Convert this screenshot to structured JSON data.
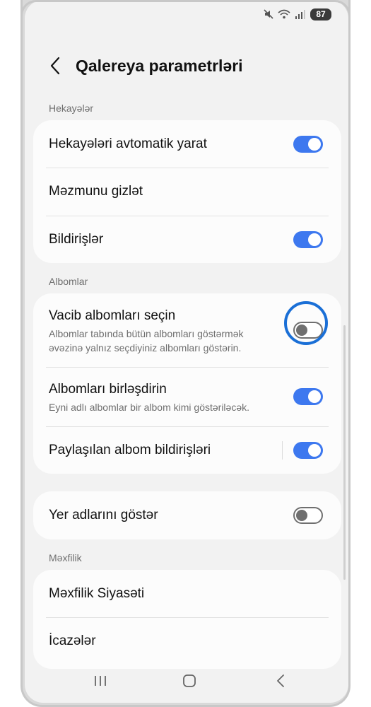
{
  "status_bar": {
    "battery": "87",
    "icons": [
      "mute-icon",
      "wifi-icon",
      "signal-icon"
    ]
  },
  "header": {
    "title": "Qalereya parametrləri",
    "back_icon": "chevron-left-icon"
  },
  "sections": {
    "stories": {
      "label": "Hekayələr",
      "items": [
        {
          "title": "Hekayələri avtomatik yarat",
          "toggle": true
        },
        {
          "title": "Məzmunu gizlət"
        },
        {
          "title": "Bildirişlər",
          "toggle": true
        }
      ]
    },
    "albums": {
      "label": "Albomlar",
      "items": [
        {
          "title": "Vacib albomları seçin",
          "subtitle_line1": "Albomlar tabında bütün albomları göstərmək",
          "subtitle_line2": "əvəzinə yalnız seçdiyiniz albomları göstərin.",
          "toggle": false
        },
        {
          "title": "Albomları birləşdirin",
          "subtitle": "Eyni adlı albomlar bir albom kimi göstəriləcək.",
          "toggle": true
        },
        {
          "title": "Paylaşılan albom bildirişləri",
          "toggle": true
        }
      ]
    },
    "location": {
      "items": [
        {
          "title": "Yer adlarını göstər",
          "toggle": false
        }
      ]
    },
    "privacy": {
      "label": "Məxfilik",
      "items": [
        {
          "title": "Məxfilik Siyasəti"
        },
        {
          "title": "İcazələr"
        }
      ]
    }
  },
  "nav_bar": {
    "icons": [
      "recent-apps-icon",
      "home-icon",
      "back-icon"
    ]
  },
  "colors": {
    "toggle_on": "#3d78ef",
    "highlight": "#1a6fd6",
    "background": "#f2f2f2",
    "card": "#fcfcfc"
  }
}
